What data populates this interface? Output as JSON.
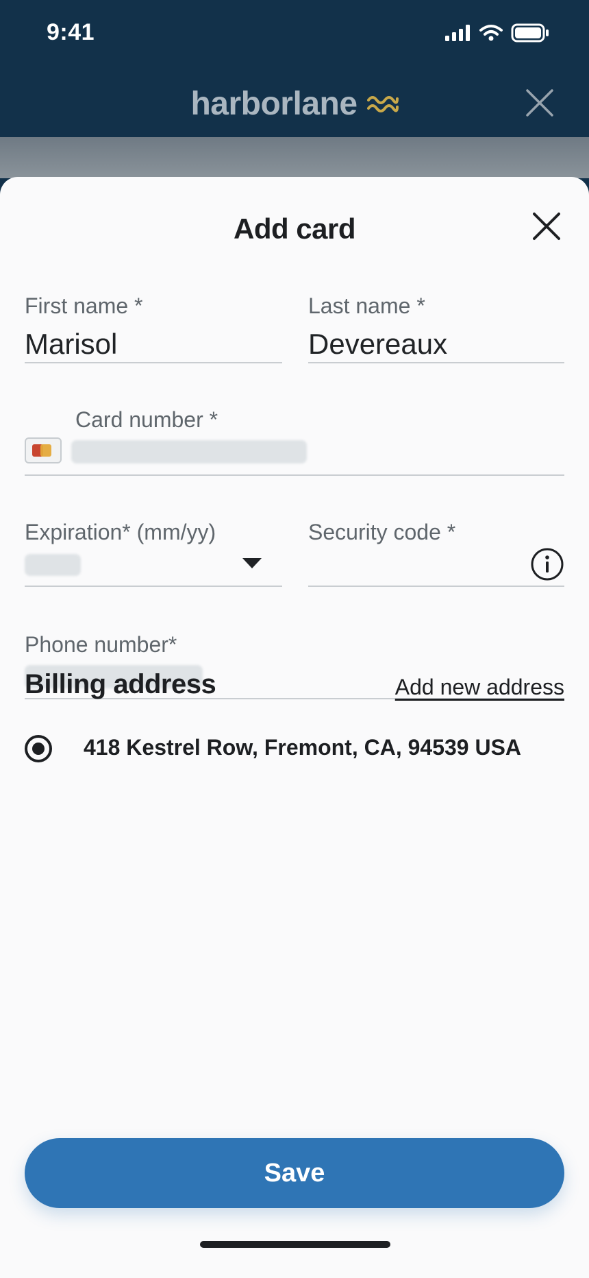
{
  "status_bar": {
    "time": "9:41"
  },
  "header": {
    "brand": "harborlane"
  },
  "sheet": {
    "title": "Add card"
  },
  "form": {
    "first_name": {
      "label": "First name *",
      "value": "Marisol"
    },
    "last_name": {
      "label": "Last name *",
      "value": "Devereaux"
    },
    "card_number": {
      "label": "Card number *"
    },
    "expiration": {
      "label": "Expiration* (mm/yy)"
    },
    "security_code": {
      "label": "Security code *"
    },
    "phone": {
      "label": "Phone number*"
    }
  },
  "billing": {
    "title": "Billing address",
    "add_new_label": "Add new address",
    "selected_address": "418 Kestrel Row, Fremont, CA, 94539 USA"
  },
  "save_label": "Save",
  "colors": {
    "header_bg": "#12314a",
    "accent": "#2f75b5",
    "brand_wave": "#c9a94a"
  }
}
